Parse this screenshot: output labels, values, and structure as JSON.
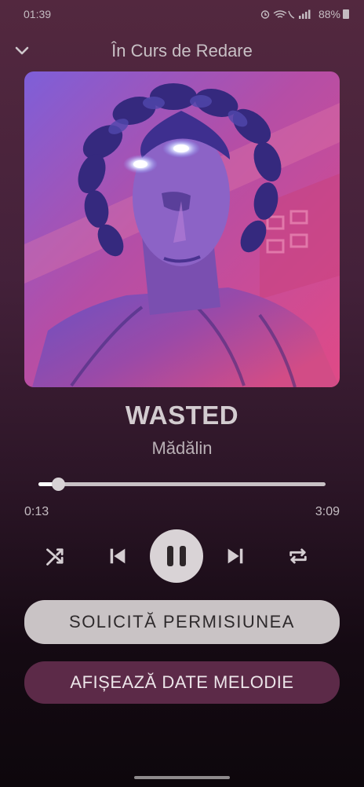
{
  "status_bar": {
    "time": "01:39",
    "battery": "88%",
    "icons": [
      "alarm-icon",
      "wifi-call-icon",
      "signal-icon",
      "battery-icon"
    ]
  },
  "header": {
    "title": "În Curs de Redare",
    "collapse_icon": "chevron-down-icon"
  },
  "track": {
    "title": "WASTED",
    "artist": "Mădălin",
    "elapsed": "0:13",
    "duration": "3:09",
    "progress_fraction": 0.069
  },
  "controls": [
    "shuffle-icon",
    "previous-icon",
    "pause-icon",
    "next-icon",
    "repeat-icon"
  ],
  "buttons": {
    "request_permission": "SOLICITĂ PERMISIUNEA",
    "show_song_data": "AFIȘEAZĂ DATE MELODIE"
  },
  "colors": {
    "background_top": "#53283f",
    "background_bottom": "#0d070c",
    "permission_button": "#c9c3c5",
    "song_data_button": "#5c2a48"
  }
}
